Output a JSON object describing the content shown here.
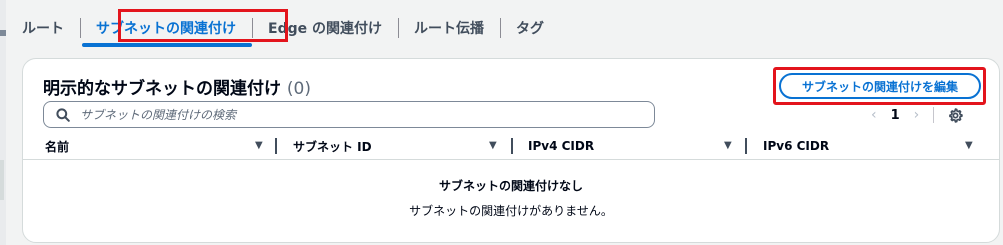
{
  "tabs": [
    {
      "label": "ルート"
    },
    {
      "label": "サブネットの関連付け"
    },
    {
      "label": "Edge の関連付け"
    },
    {
      "label": "ルート伝播"
    },
    {
      "label": "タグ"
    }
  ],
  "active_tab": "サブネットの関連付け",
  "panel": {
    "title": "明示的なサブネットの関連付け",
    "count": "(0)",
    "edit_button": "サブネットの関連付けを編集",
    "search_placeholder": "サブネットの関連付けの検索",
    "pagination": {
      "current_page": "1"
    }
  },
  "table": {
    "columns": [
      "名前",
      "サブネット ID",
      "IPv4 CIDR",
      "IPv6 CIDR"
    ],
    "empty_title": "サブネットの関連付けなし",
    "empty_description": "サブネットの関連付けがありません。"
  },
  "colors": {
    "accent": "#0972d3",
    "highlight": "#e3141c"
  },
  "icons": [
    "search-icon",
    "chevron-left-icon",
    "chevron-right-icon",
    "gear-icon",
    "sort-caret-icon"
  ]
}
